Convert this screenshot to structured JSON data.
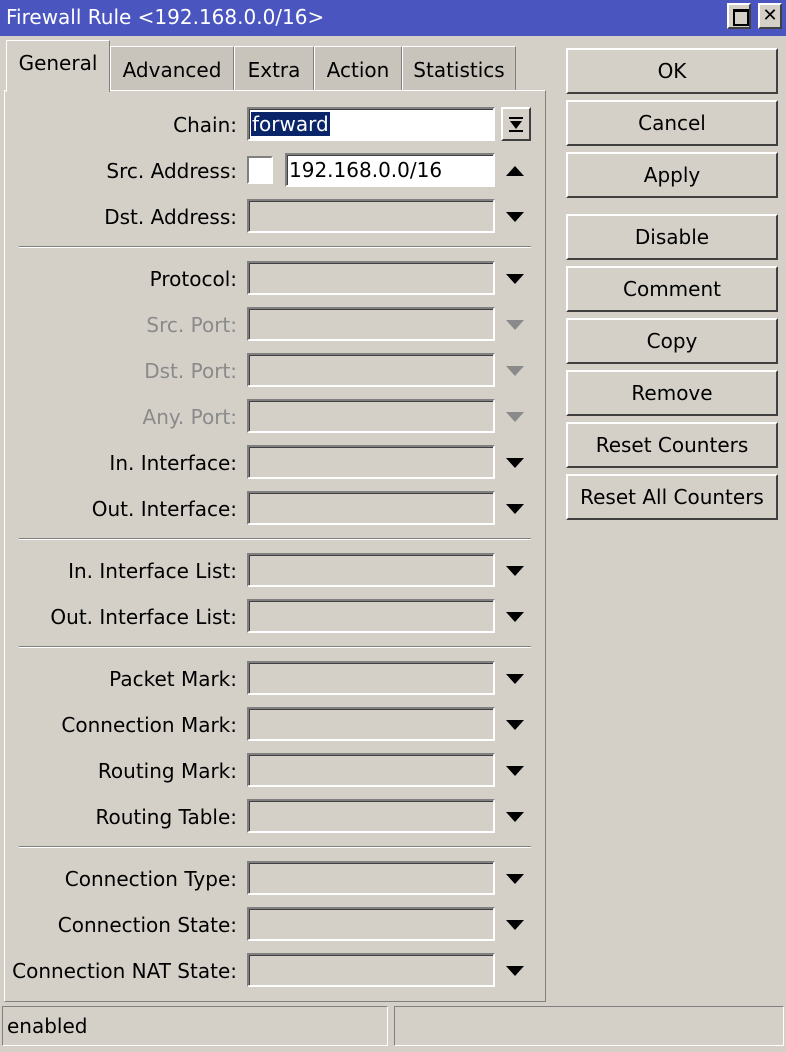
{
  "window": {
    "title": "Firewall Rule <192.168.0.0/16>"
  },
  "tabs": [
    "General",
    "Advanced",
    "Extra",
    "Action",
    "Statistics"
  ],
  "active_tab": "General",
  "form": {
    "chain": {
      "label": "Chain:",
      "value": "forward"
    },
    "src_address": {
      "label": "Src. Address:",
      "value": "192.168.0.0/16",
      "negate_checked": false
    },
    "dst_address": {
      "label": "Dst. Address:",
      "value": ""
    },
    "protocol": {
      "label": "Protocol:",
      "value": ""
    },
    "src_port": {
      "label": "Src. Port:",
      "value": "",
      "disabled": true
    },
    "dst_port": {
      "label": "Dst. Port:",
      "value": "",
      "disabled": true
    },
    "any_port": {
      "label": "Any. Port:",
      "value": "",
      "disabled": true
    },
    "in_interface": {
      "label": "In. Interface:",
      "value": ""
    },
    "out_interface": {
      "label": "Out. Interface:",
      "value": ""
    },
    "in_interface_list": {
      "label": "In. Interface List:",
      "value": ""
    },
    "out_interface_list": {
      "label": "Out. Interface List:",
      "value": ""
    },
    "packet_mark": {
      "label": "Packet Mark:",
      "value": ""
    },
    "connection_mark": {
      "label": "Connection Mark:",
      "value": ""
    },
    "routing_mark": {
      "label": "Routing Mark:",
      "value": ""
    },
    "routing_table": {
      "label": "Routing Table:",
      "value": ""
    },
    "connection_type": {
      "label": "Connection Type:",
      "value": ""
    },
    "connection_state": {
      "label": "Connection State:",
      "value": ""
    },
    "connection_nat_state": {
      "label": "Connection NAT State:",
      "value": ""
    }
  },
  "buttons": {
    "ok": "OK",
    "cancel": "Cancel",
    "apply": "Apply",
    "disable": "Disable",
    "comment": "Comment",
    "copy": "Copy",
    "remove": "Remove",
    "reset_counters": "Reset Counters",
    "reset_all_counters": "Reset All Counters"
  },
  "status": {
    "left": "enabled",
    "right": ""
  },
  "icons": {
    "dropdown": "triangle-down-icon",
    "collapse": "triangle-up-icon",
    "combo": "combo-arrow-icon"
  },
  "colors": {
    "titlebar": "#4a55c0",
    "window_bg": "#d4d0c8",
    "selection": "#0a246a",
    "disabled_text": "#8a8a8a"
  }
}
